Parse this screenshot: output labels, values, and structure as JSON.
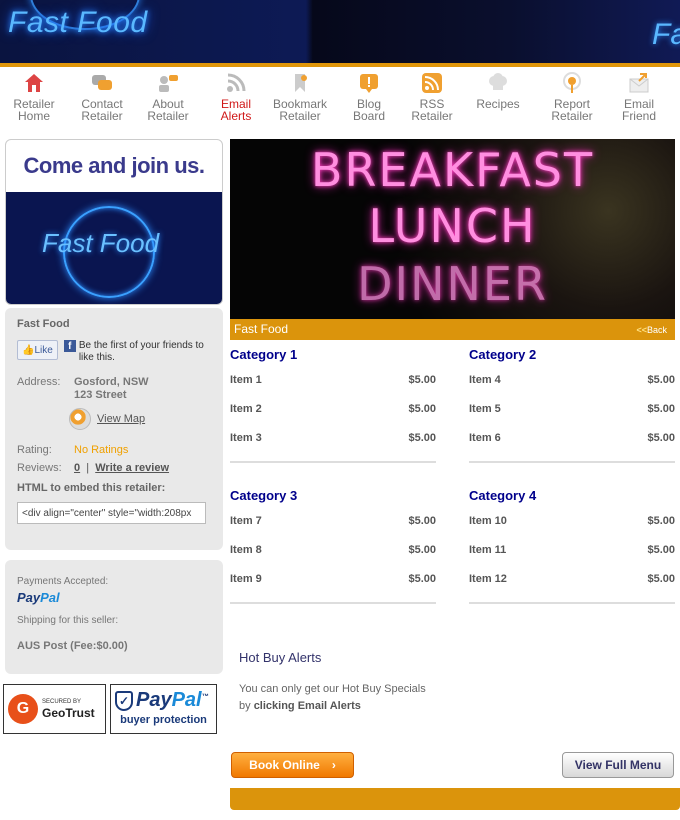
{
  "banner": {
    "logo": "Fast Food",
    "logo_right": "Fa"
  },
  "nav": [
    {
      "label": "Retailer\nHome",
      "icon": "home-icon",
      "color": "#d44"
    },
    {
      "label": "Contact\nRetailer",
      "icon": "chat-icon",
      "color": "#999"
    },
    {
      "label": "About\nRetailer",
      "icon": "people-icon",
      "color": "#f0a030"
    },
    {
      "label": "Email\nAlerts",
      "icon": "rss-icon",
      "color": "#bbb",
      "active": true
    },
    {
      "label": "Bookmark\nRetailer",
      "icon": "bookmark-icon",
      "color": "#f0a030"
    },
    {
      "label": "Blog\nBoard",
      "icon": "exclamation-icon",
      "color": "#f0a030"
    },
    {
      "label": "RSS\nRetailer",
      "icon": "rss-feed-icon",
      "color": "#f0a030"
    },
    {
      "label": "Recipes",
      "icon": "chef-hat-icon",
      "color": "#ccc"
    },
    {
      "label": "Report\nRetailer",
      "icon": "podcast-icon",
      "color": "#f0a030"
    },
    {
      "label": "Email\nFriend",
      "icon": "envelope-icon",
      "color": "#f0a030"
    }
  ],
  "sidebar": {
    "join_text": "Come and join us.",
    "join_logo": "Fast Food",
    "name": "Fast Food",
    "fb_like": "Like",
    "fb_text": "Be the first of your friends to like this.",
    "address_label": "Address:",
    "address_line1": "Gosford, NSW",
    "address_line2": "123 Street",
    "view_map": "View Map",
    "rating_label": "Rating:",
    "rating_value": "No Ratings",
    "reviews_label": "Reviews:",
    "reviews_count": "0",
    "reviews_sep": "|",
    "write_review": "Write a review",
    "embed_label": "HTML to embed this retailer:",
    "embed_value": "<div align=\"center\" style=\"width:208px",
    "payments_label": "Payments Accepted:",
    "paypal_pay": "Pay",
    "paypal_pal": "Pal",
    "shipping_label": "Shipping for this seller:",
    "shipping_value": "AUS Post (Fee:$0.00)"
  },
  "badges": {
    "geotrust_secured": "SECURED BY",
    "geotrust_name": "GeoTrust",
    "paypal_pay": "Pay",
    "paypal_pal": "Pal",
    "paypal_tm": "™",
    "paypal_bp": "buyer protection"
  },
  "hero": {
    "line1": "BREAKFAST",
    "line2": "LUNCH",
    "line3": "DINNER"
  },
  "menu": {
    "title": "Fast Food",
    "back_arrows": "<<",
    "back": "Back",
    "categories": [
      {
        "name": "Category 1",
        "items": [
          {
            "name": "Item 1",
            "price": "$5.00"
          },
          {
            "name": "Item 2",
            "price": "$5.00"
          },
          {
            "name": "Item 3",
            "price": "$5.00"
          }
        ]
      },
      {
        "name": "Category 2",
        "items": [
          {
            "name": "Item 4",
            "price": "$5.00"
          },
          {
            "name": "Item 5",
            "price": "$5.00"
          },
          {
            "name": "Item 6",
            "price": "$5.00"
          }
        ]
      },
      {
        "name": "Category 3",
        "items": [
          {
            "name": "Item 7",
            "price": "$5.00"
          },
          {
            "name": "Item 8",
            "price": "$5.00"
          },
          {
            "name": "Item 9",
            "price": "$5.00"
          }
        ]
      },
      {
        "name": "Category 4",
        "items": [
          {
            "name": "Item 10",
            "price": "$5.00"
          },
          {
            "name": "Item 11",
            "price": "$5.00"
          },
          {
            "name": "Item 12",
            "price": "$5.00"
          }
        ]
      }
    ]
  },
  "hotbuy": {
    "title": "Hot Buy Alerts",
    "text_prefix": "You can only get our Hot Buy Specials",
    "text_by": "by",
    "text_bold": "clicking Email Alerts"
  },
  "buttons": {
    "book": "Book Online",
    "book_arrow": "›",
    "view_menu": "View Full Menu"
  },
  "colors": {
    "accent": "#db940c",
    "category": "#00008b",
    "alert_active": "#d01818"
  }
}
